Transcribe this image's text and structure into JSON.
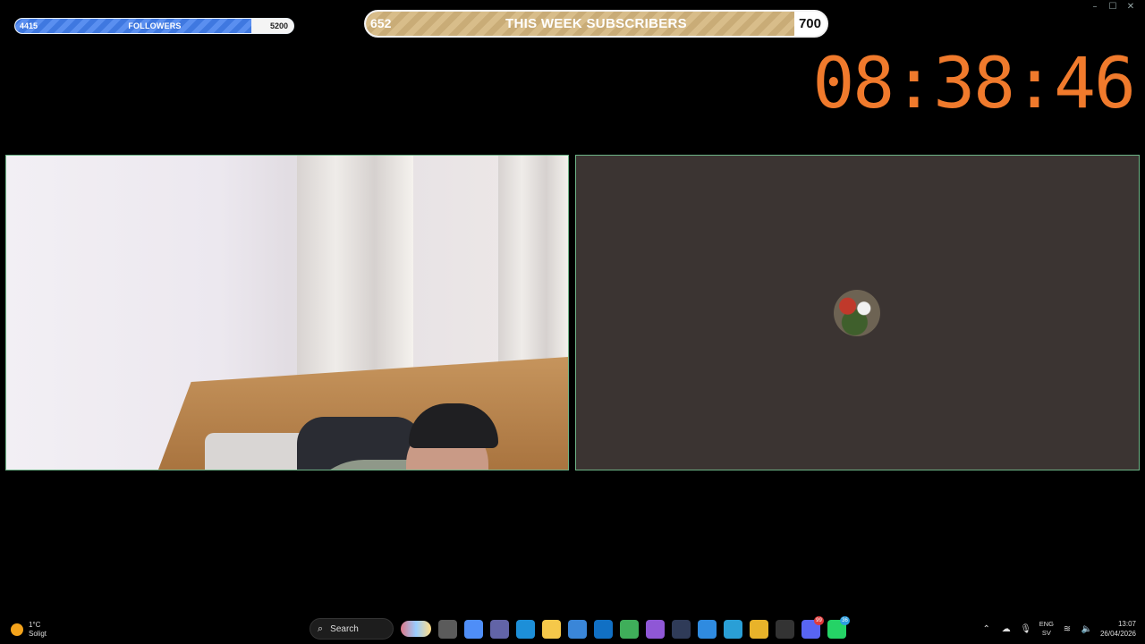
{
  "window": {
    "controls": [
      "–",
      "☐",
      "✕"
    ]
  },
  "followers": {
    "current": "4415",
    "title": "FOLLOWERS",
    "goal": "5200",
    "progress": 0.849
  },
  "subscribers": {
    "current": "652",
    "title": "THIS WEEK SUBSCRIBERS",
    "goal": "700",
    "progress": 0.931
  },
  "clock": {
    "time": "08:38:46"
  },
  "taskbar": {
    "weather": {
      "temp": "1°C",
      "condition": "Soligt"
    },
    "search_label": "Search",
    "apps": [
      {
        "name": "file-explorer-files-icon",
        "color": "#5b5b5b"
      },
      {
        "name": "copilot-icon",
        "color": "#4f8ef7"
      },
      {
        "name": "teams-icon",
        "color": "#6264a7"
      },
      {
        "name": "edge-icon",
        "color": "#1d8fd8"
      },
      {
        "name": "folder-icon",
        "color": "#f5c84a"
      },
      {
        "name": "store-icon",
        "color": "#3a86d8"
      },
      {
        "name": "outlook-icon",
        "color": "#1170c4"
      },
      {
        "name": "shield-icon",
        "color": "#3fae5a"
      },
      {
        "name": "m365-icon",
        "color": "#8f57d6"
      },
      {
        "name": "app-cube-icon",
        "color": "#2f3b58"
      },
      {
        "name": "photos-icon",
        "color": "#2f8be0"
      },
      {
        "name": "whiteboard-icon",
        "color": "#2a9fd6"
      },
      {
        "name": "chrome-icon",
        "color": "#e8b32a"
      },
      {
        "name": "obs-icon",
        "color": "#333333"
      },
      {
        "name": "discord-icon",
        "color": "#5865f2",
        "badge": "99"
      },
      {
        "name": "whatsapp-icon",
        "color": "#25d366",
        "badge": "36"
      }
    ],
    "tray": {
      "lang": "ENG",
      "region": "SV",
      "time": "13:07",
      "date": "26/04/2026"
    }
  }
}
